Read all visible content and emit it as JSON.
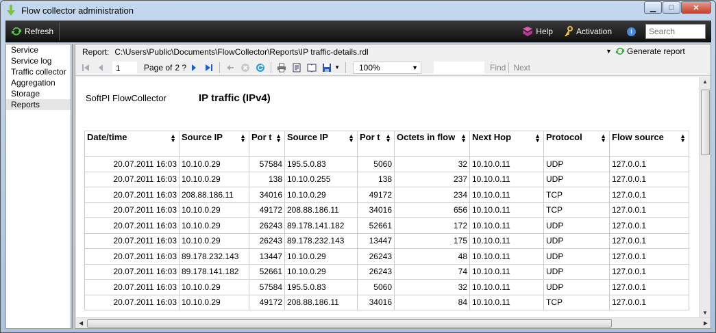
{
  "window": {
    "title": "Flow collector administration",
    "buttons": {
      "minimize": "▁",
      "maximize": "□",
      "close": "✕"
    }
  },
  "toolbar": {
    "refresh_label": "Refresh",
    "help_label": "Help",
    "activation_label": "Activation",
    "search_placeholder": "Search"
  },
  "sidebar": {
    "items": [
      {
        "label": "Service"
      },
      {
        "label": "Service log"
      },
      {
        "label": "Traffic collector"
      },
      {
        "label": "Aggregation"
      },
      {
        "label": "Storage"
      },
      {
        "label": "Reports",
        "selected": true
      }
    ]
  },
  "report_bar": {
    "label": "Report:",
    "path": "C:\\Users\\Public\\Documents\\FlowCollector\\Reports\\IP traffic-details.rdl",
    "generate_label": "Generate report"
  },
  "viewer": {
    "page_current": "1",
    "page_of": "Page of",
    "page_total": "2 ?",
    "zoom": "100%",
    "find_label": "Find",
    "next_label": "Next"
  },
  "report": {
    "brand": "SoftPI FlowCollector",
    "title": "IP traffic (IPv4)",
    "columns": [
      "Date/time",
      "Source IP",
      "Por t",
      "Source IP",
      "Por t",
      "Octets in flow",
      "Next Hop",
      "Protocol",
      "Flow source"
    ],
    "rows": [
      [
        "20.07.2011 16:03",
        "10.10.0.29",
        "57584",
        "195.5.0.83",
        "5060",
        "32",
        "10.10.0.11",
        "UDP",
        "127.0.0.1"
      ],
      [
        "20.07.2011 16:03",
        "10.10.0.29",
        "138",
        "10.10.0.255",
        "138",
        "237",
        "10.10.0.11",
        "UDP",
        "127.0.0.1"
      ],
      [
        "20.07.2011 16:03",
        "208.88.186.11",
        "34016",
        "10.10.0.29",
        "49172",
        "234",
        "10.10.0.11",
        "TCP",
        "127.0.0.1"
      ],
      [
        "20.07.2011 16:03",
        "10.10.0.29",
        "49172",
        "208.88.186.11",
        "34016",
        "656",
        "10.10.0.11",
        "TCP",
        "127.0.0.1"
      ],
      [
        "20.07.2011 16:03",
        "10.10.0.29",
        "26243",
        "89.178.141.182",
        "52661",
        "172",
        "10.10.0.11",
        "UDP",
        "127.0.0.1"
      ],
      [
        "20.07.2011 16:03",
        "10.10.0.29",
        "26243",
        "89.178.232.143",
        "13447",
        "175",
        "10.10.0.11",
        "UDP",
        "127.0.0.1"
      ],
      [
        "20.07.2011 16:03",
        "89.178.232.143",
        "13447",
        "10.10.0.29",
        "26243",
        "48",
        "10.10.0.11",
        "UDP",
        "127.0.0.1"
      ],
      [
        "20.07.2011 16:03",
        "89.178.141.182",
        "52661",
        "10.10.0.29",
        "26243",
        "74",
        "10.10.0.11",
        "UDP",
        "127.0.0.1"
      ],
      [
        "20.07.2011 16:03",
        "10.10.0.29",
        "57584",
        "195.5.0.83",
        "5060",
        "32",
        "10.10.0.11",
        "UDP",
        "127.0.0.1"
      ],
      [
        "20.07.2011 16:03",
        "10.10.0.29",
        "49172",
        "208.88.186.11",
        "34016",
        "84",
        "10.10.0.11",
        "TCP",
        "127.0.0.1"
      ]
    ]
  }
}
